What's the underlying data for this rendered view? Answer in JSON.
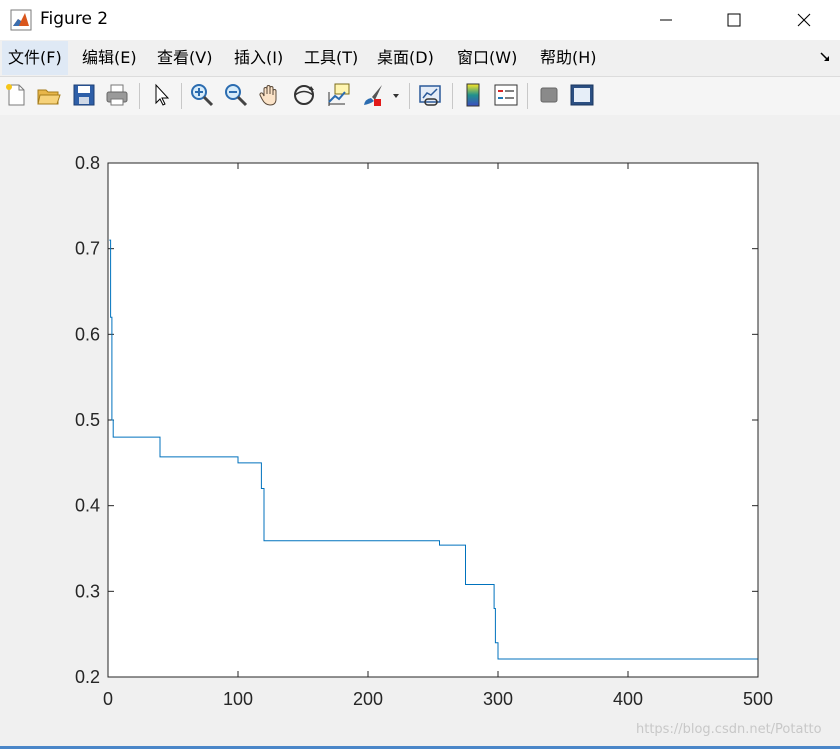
{
  "window": {
    "title": "Figure 2",
    "minimize_symbol": "—",
    "maximize_symbol": "☐",
    "close_symbol": "✕"
  },
  "menu": {
    "items": [
      {
        "label": "文件(F)"
      },
      {
        "label": "编辑(E)"
      },
      {
        "label": "查看(V)"
      },
      {
        "label": "插入(I)"
      },
      {
        "label": "工具(T)"
      },
      {
        "label": "桌面(D)"
      },
      {
        "label": "窗口(W)"
      },
      {
        "label": "帮助(H)"
      }
    ]
  },
  "toolbar": {
    "icons": [
      "new-figure-icon",
      "open-file-icon",
      "save-icon",
      "print-icon",
      "edit-plot-arrow-icon",
      "zoom-in-icon",
      "zoom-out-icon",
      "pan-hand-icon",
      "rotate-3d-icon",
      "data-cursor-icon",
      "brush-icon",
      "brush-dropdown-icon",
      "link-plot-icon",
      "colorbar-icon",
      "legend-icon",
      "hide-plot-tools-icon",
      "show-plot-tools-icon"
    ]
  },
  "chart_data": {
    "type": "line",
    "title": "",
    "xlabel": "",
    "ylabel": "",
    "xlim": [
      0,
      500
    ],
    "ylim": [
      0.2,
      0.8
    ],
    "xticks": [
      0,
      100,
      200,
      300,
      400,
      500
    ],
    "yticks": [
      0.2,
      0.3,
      0.4,
      0.5,
      0.6,
      0.7,
      0.8
    ],
    "xtick_labels": [
      "0",
      "100",
      "200",
      "300",
      "400",
      "500"
    ],
    "ytick_labels": [
      "0.2",
      "0.3",
      "0.4",
      "0.5",
      "0.6",
      "0.7",
      "0.8"
    ],
    "grid": false,
    "line_color": "#0072bd",
    "series": [
      {
        "x": [
          1,
          2,
          2,
          3,
          3,
          4,
          4,
          40,
          40,
          100,
          100,
          118,
          118,
          120,
          120,
          255,
          255,
          275,
          275,
          297,
          297,
          298,
          298,
          300,
          300,
          500
        ],
        "y": [
          0.71,
          0.71,
          0.62,
          0.62,
          0.5,
          0.5,
          0.48,
          0.48,
          0.457,
          0.457,
          0.45,
          0.45,
          0.42,
          0.42,
          0.359,
          0.359,
          0.354,
          0.354,
          0.308,
          0.308,
          0.28,
          0.28,
          0.24,
          0.24,
          0.221,
          0.221
        ]
      }
    ]
  },
  "watermark": {
    "text": "https://blog.csdn.net/Potatto"
  }
}
